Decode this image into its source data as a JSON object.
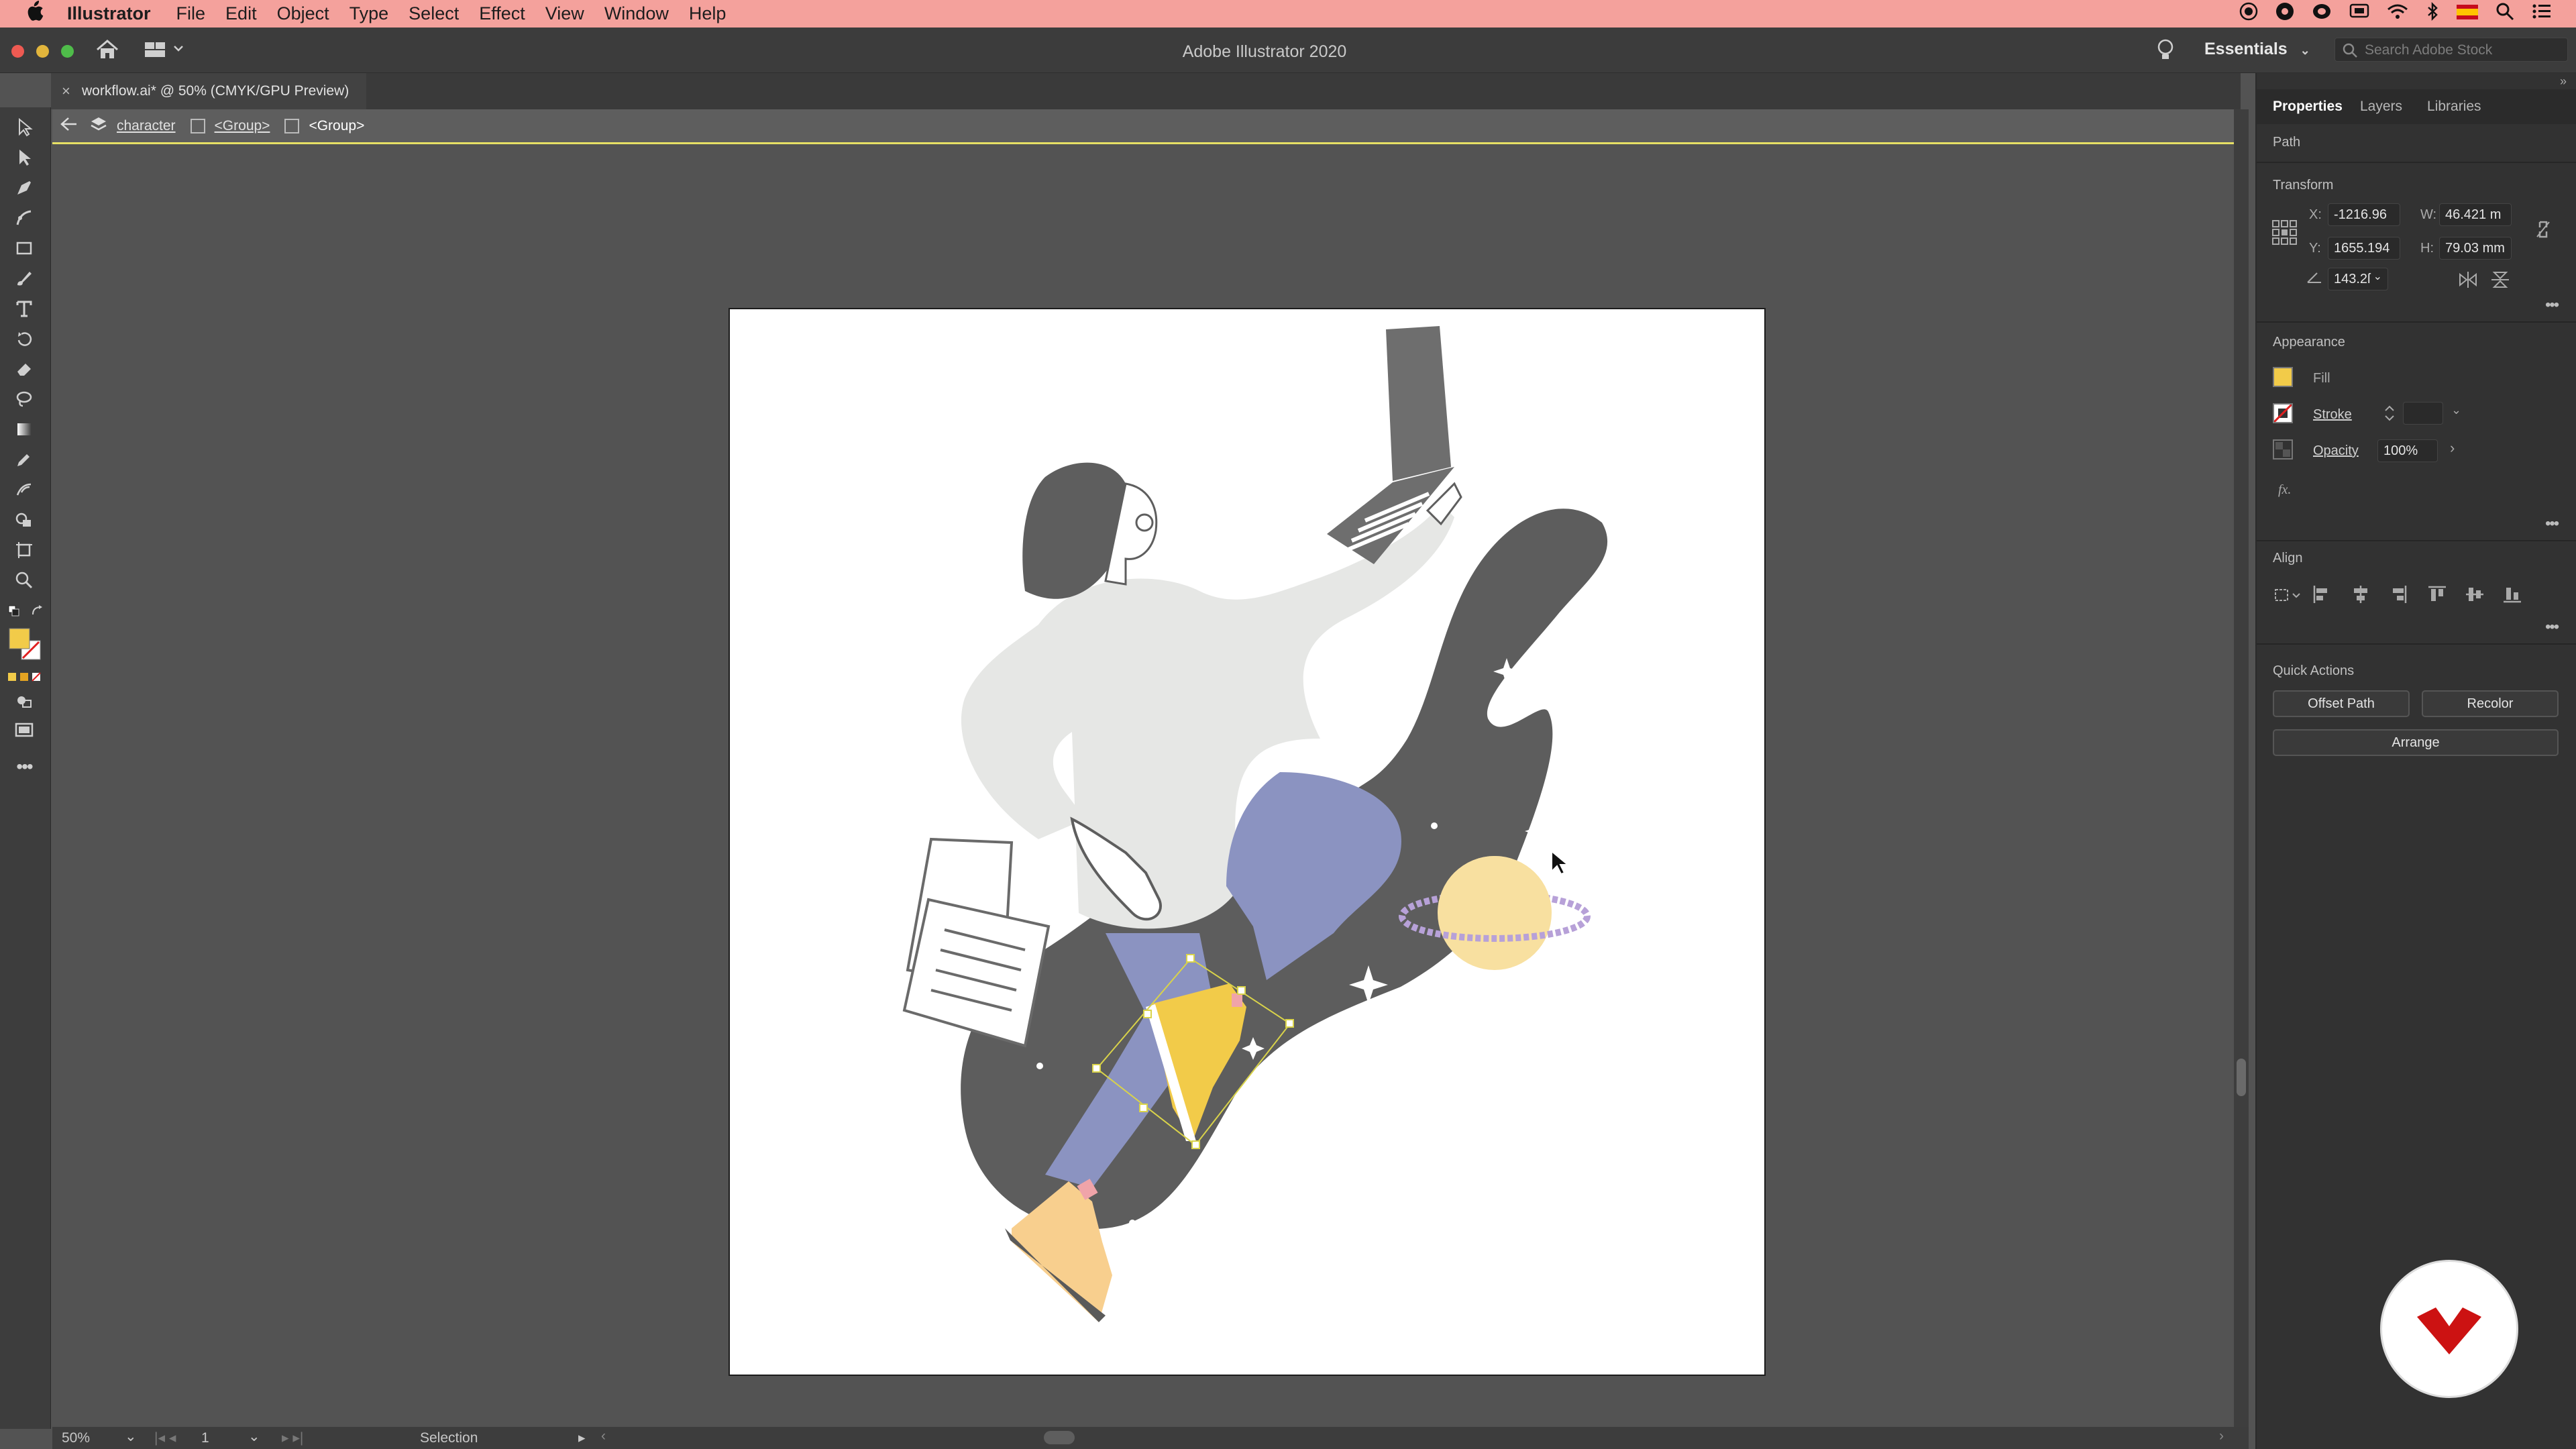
{
  "menubar": {
    "app_name": "Illustrator",
    "items": [
      "File",
      "Edit",
      "Object",
      "Type",
      "Select",
      "Effect",
      "View",
      "Window",
      "Help"
    ]
  },
  "appbar": {
    "title": "Adobe Illustrator 2020",
    "workspace": "Essentials",
    "search_placeholder": "Search Adobe Stock"
  },
  "document": {
    "tab_label": "workflow.ai* @ 50% (CMYK/GPU Preview)"
  },
  "isolation": {
    "crumbs": [
      "character",
      "<Group>",
      "<Group>"
    ]
  },
  "panel": {
    "tabs": [
      "Properties",
      "Layers",
      "Libraries"
    ],
    "selection_type": "Path",
    "transform": {
      "title": "Transform",
      "x_label": "X:",
      "x": "-1216.96",
      "y_label": "Y:",
      "y": "1655.194",
      "w_label": "W:",
      "w": "46.421 m",
      "h_label": "H:",
      "h": "79.03 mm",
      "angle": "143.2ſ"
    },
    "appearance": {
      "title": "Appearance",
      "fill_label": "Fill",
      "stroke_label": "Stroke",
      "opacity_label": "Opacity",
      "opacity": "100%",
      "fx_label": "fx."
    },
    "align": {
      "title": "Align"
    },
    "quick_actions": {
      "title": "Quick Actions",
      "offset_path": "Offset Path",
      "recolor": "Recolor",
      "arrange": "Arrange"
    }
  },
  "status": {
    "zoom": "50%",
    "artboard": "1",
    "tool": "Selection"
  },
  "colors": {
    "menubar": "#f4a19c",
    "fill": "#f2cb49",
    "selection": "#e6e065",
    "logo_accent": "#cc1212"
  }
}
